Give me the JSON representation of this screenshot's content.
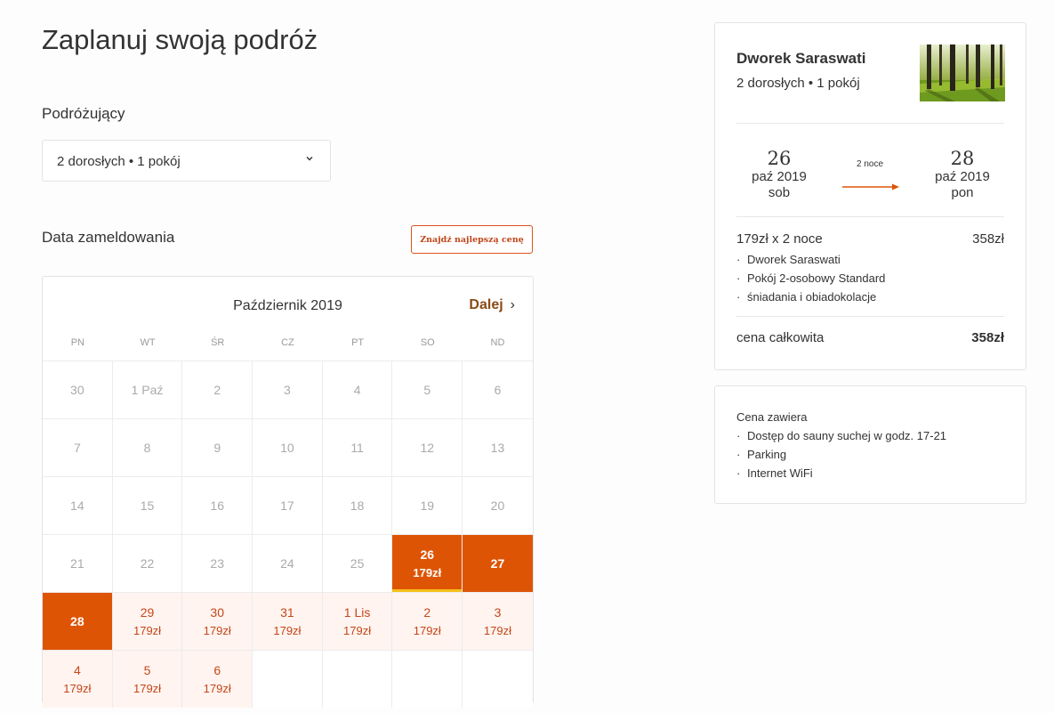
{
  "page": {
    "title": "Zaplanuj swoją podróż"
  },
  "travelers": {
    "label": "Podróżujący",
    "value": "2 dorosłych • 1 pokój"
  },
  "checkin": {
    "label": "Data zameldowania",
    "best_price_button": "Znajdź najlepszą cenę"
  },
  "calendar": {
    "month": "Październik 2019",
    "next": "Dalej",
    "weekdays": [
      "PN",
      "WT",
      "ŚR",
      "CZ",
      "PT",
      "SO",
      "ND"
    ],
    "weeks": [
      [
        {
          "d": "30",
          "s": "disabled"
        },
        {
          "d": "1 Paź",
          "s": "disabled"
        },
        {
          "d": "2",
          "s": "disabled"
        },
        {
          "d": "3",
          "s": "disabled"
        },
        {
          "d": "4",
          "s": "disabled"
        },
        {
          "d": "5",
          "s": "disabled"
        },
        {
          "d": "6",
          "s": "disabled"
        }
      ],
      [
        {
          "d": "7",
          "s": "disabled"
        },
        {
          "d": "8",
          "s": "disabled"
        },
        {
          "d": "9",
          "s": "disabled"
        },
        {
          "d": "10",
          "s": "disabled"
        },
        {
          "d": "11",
          "s": "disabled"
        },
        {
          "d": "12",
          "s": "disabled"
        },
        {
          "d": "13",
          "s": "disabled"
        }
      ],
      [
        {
          "d": "14",
          "s": "disabled"
        },
        {
          "d": "15",
          "s": "disabled"
        },
        {
          "d": "16",
          "s": "disabled"
        },
        {
          "d": "17",
          "s": "disabled"
        },
        {
          "d": "18",
          "s": "disabled"
        },
        {
          "d": "19",
          "s": "disabled"
        },
        {
          "d": "20",
          "s": "disabled"
        }
      ],
      [
        {
          "d": "21",
          "s": "disabled"
        },
        {
          "d": "22",
          "s": "disabled"
        },
        {
          "d": "23",
          "s": "disabled"
        },
        {
          "d": "24",
          "s": "disabled"
        },
        {
          "d": "25",
          "s": "disabled"
        },
        {
          "d": "26",
          "p": "179zł",
          "s": "selected-start"
        },
        {
          "d": "27",
          "s": "selected"
        }
      ],
      [
        {
          "d": "28",
          "s": "selected"
        },
        {
          "d": "29",
          "p": "179zł",
          "s": "available"
        },
        {
          "d": "30",
          "p": "179zł",
          "s": "available"
        },
        {
          "d": "31",
          "p": "179zł",
          "s": "available"
        },
        {
          "d": "1 Lis",
          "p": "179zł",
          "s": "available"
        },
        {
          "d": "2",
          "p": "179zł",
          "s": "available"
        },
        {
          "d": "3",
          "p": "179zł",
          "s": "available"
        }
      ],
      [
        {
          "d": "4",
          "p": "179zł",
          "s": "available"
        },
        {
          "d": "5",
          "p": "179zł",
          "s": "available"
        },
        {
          "d": "6",
          "p": "179zł",
          "s": "available"
        },
        {
          "d": "",
          "s": "empty"
        },
        {
          "d": "",
          "s": "empty"
        },
        {
          "d": "",
          "s": "empty"
        },
        {
          "d": "",
          "s": "empty"
        }
      ]
    ]
  },
  "summary": {
    "hotel_name": "Dworek Saraswati",
    "guests": "2 dorosłych • 1 pokój",
    "checkin": {
      "day": "26",
      "month_year": "paź 2019",
      "weekday": "sob"
    },
    "checkout": {
      "day": "28",
      "month_year": "paź 2019",
      "weekday": "pon"
    },
    "nights": "2 noce",
    "line_label": "179zł x 2 noce",
    "line_amount": "358zł",
    "details": [
      "Dworek Saraswati",
      "Pokój 2-osobowy Standard",
      "śniadania i obiadokolacje"
    ],
    "total_label": "cena całkowita",
    "total_amount": "358zł"
  },
  "includes": {
    "title": "Cena zawiera",
    "items": [
      "Dostęp do sauny suchej w godz. 17-21",
      "Parking",
      "Internet WiFi"
    ]
  },
  "colors": {
    "accent": "#de5405",
    "accent_text": "#c5461a",
    "available_bg": "#fff4ef",
    "start_marker": "#f5c01a"
  }
}
